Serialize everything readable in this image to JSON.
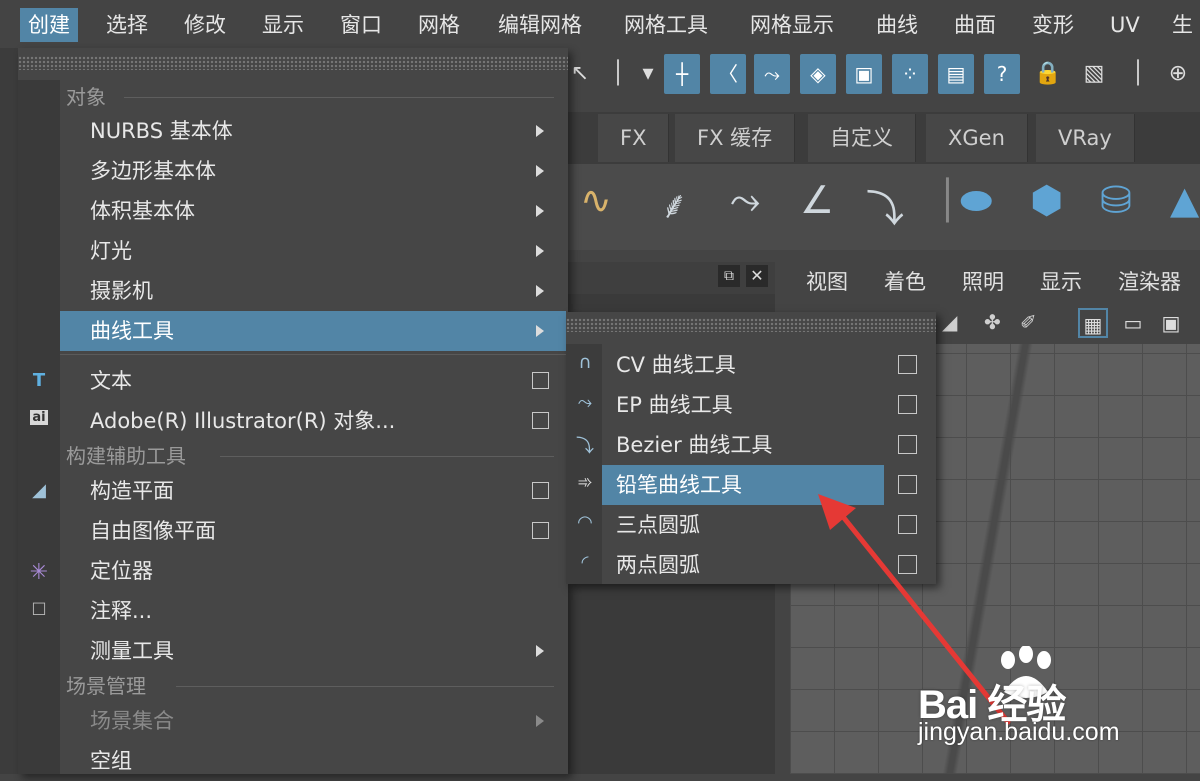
{
  "menubar": {
    "items": [
      "创建",
      "选择",
      "修改",
      "显示",
      "窗口",
      "网格",
      "编辑网格",
      "网格工具",
      "网格显示",
      "曲线",
      "曲面",
      "变形",
      "UV",
      "生"
    ],
    "active_index": 0
  },
  "shelf_tabs": [
    "FX",
    "FX 缓存",
    "自定义",
    "XGen",
    "VRay"
  ],
  "viewport_menu": [
    "视图",
    "着色",
    "照明",
    "显示",
    "渲染器"
  ],
  "create_menu": {
    "sections": {
      "objects": "对象",
      "construction_aids": "构建辅助工具",
      "scene_management": "场景管理"
    },
    "items": {
      "nurbs": "NURBS 基本体",
      "polygon": "多边形基本体",
      "volume": "体积基本体",
      "lights": "灯光",
      "cameras": "摄影机",
      "curve_tools": "曲线工具",
      "text": "文本",
      "illustrator": "Adobe(R) Illustrator(R) 对象...",
      "construction_plane": "构造平面",
      "free_image_plane": "自由图像平面",
      "locator": "定位器",
      "annotation": "注释...",
      "measure_tools": "测量工具",
      "sets": "场景集合",
      "empty_group": "空组"
    },
    "highlighted": "curve_tools"
  },
  "curve_submenu": {
    "items": [
      "CV 曲线工具",
      "EP 曲线工具",
      "Bezier 曲线工具",
      "铅笔曲线工具",
      "三点圆弧",
      "两点圆弧"
    ],
    "highlighted_index": 3
  },
  "watermark": {
    "brand": "Bai 经验",
    "url": "jingyan.baidu.com"
  },
  "colors": {
    "accent": "#5285a6",
    "menu_bg": "#464646",
    "annotation_arrow": "#e53935"
  }
}
